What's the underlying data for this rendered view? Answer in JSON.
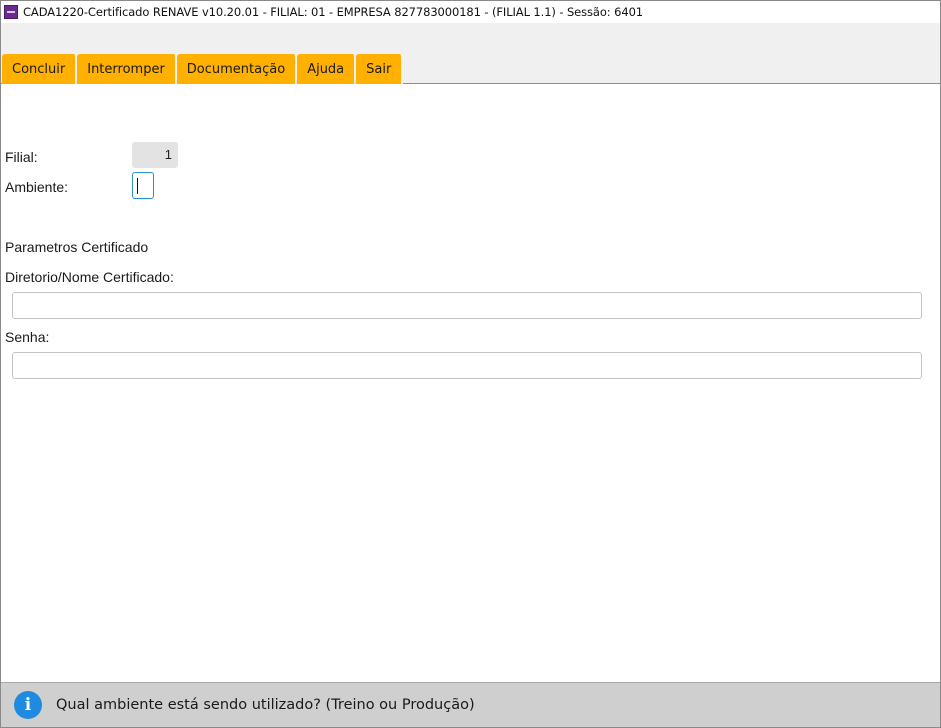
{
  "window": {
    "title": "CADA1220-Certificado RENAVE v10.20.01   - FILIAL: 01 - EMPRESA 827783000181 - (FILIAL 1.1) - Sessão: 6401",
    "icon": "app-icon"
  },
  "toolbar": {
    "tabs": [
      {
        "label": "Concluir"
      },
      {
        "label": "Interromper"
      },
      {
        "label": "Documentação"
      },
      {
        "label": "Ajuda"
      },
      {
        "label": "Sair"
      }
    ],
    "accent_color": "#ffb000"
  },
  "form": {
    "filial_label": "Filial:",
    "filial_value": "1",
    "ambiente_label": "Ambiente:",
    "ambiente_value": "",
    "section_title": "Parametros Certificado",
    "diretorio_label": "Diretorio/Nome Certificado:",
    "diretorio_value": "",
    "senha_label": "Senha:",
    "senha_value": ""
  },
  "status": {
    "icon": "info-icon",
    "message": "Qual ambiente está sendo utilizado? (Treino ou Produção)",
    "icon_color": "#1f8ae0"
  }
}
